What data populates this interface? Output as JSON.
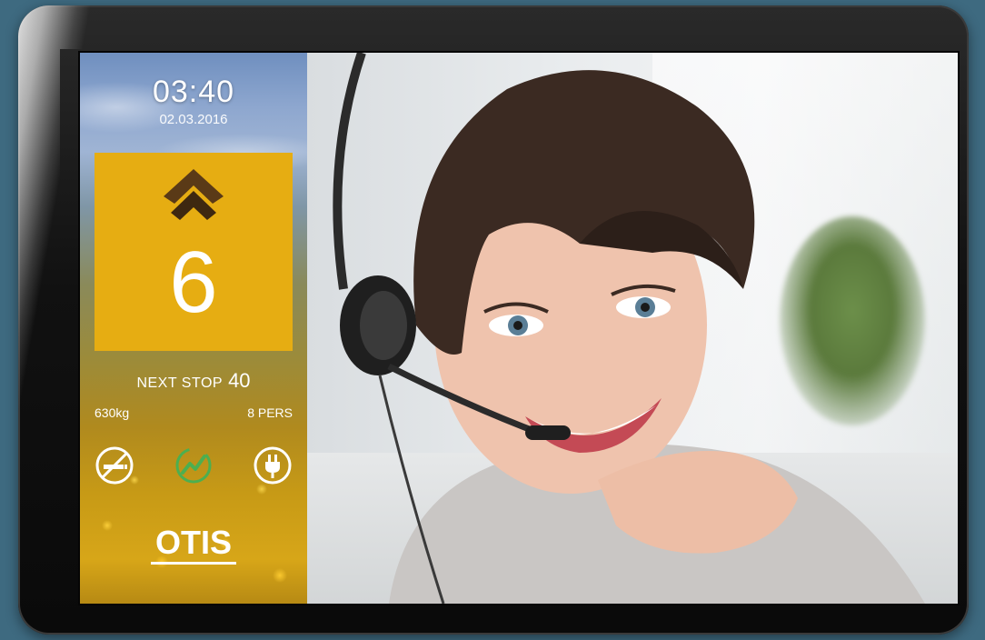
{
  "clock": {
    "time": "03:40",
    "date": "02.03.2016"
  },
  "floor": {
    "direction_icon": "chevron-double-up-icon",
    "number": "6"
  },
  "next_stop": {
    "label": "NEXT STOP",
    "value": "40"
  },
  "load": {
    "weight": "630kg",
    "persons": "8 PERS"
  },
  "status_icons": [
    "no-smoking-icon",
    "energy-saving-icon",
    "power-plug-icon"
  ],
  "brand": {
    "logo_text": "OTIS"
  },
  "colors": {
    "floor_box": "#e6ad12",
    "direction_arrow": "#5a3a17",
    "energy_icon": "#4caf50",
    "bezel": "#111111",
    "background": "#3e6a80"
  }
}
